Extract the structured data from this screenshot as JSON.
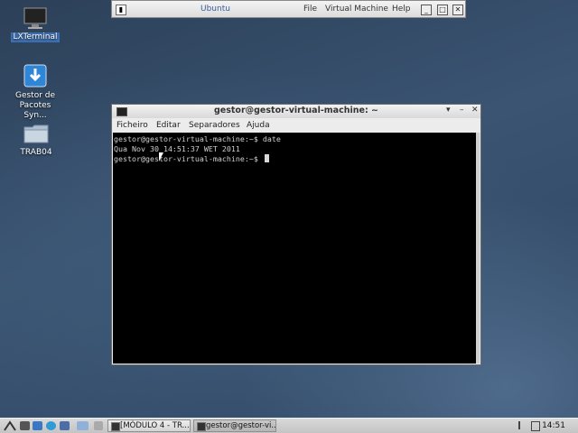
{
  "desktop": {
    "icons": [
      {
        "label": "LXTerminal"
      },
      {
        "label": "Gestor de Pacotes Syn..."
      },
      {
        "label": "TRAB04"
      }
    ]
  },
  "vm_window": {
    "title": "Ubuntu",
    "menu": [
      "File",
      "Virtual Machine",
      "Help"
    ],
    "controls": [
      "_",
      "□",
      "✕"
    ]
  },
  "terminal": {
    "title": "gestor@gestor-virtual-machine: ~",
    "controls": [
      "▾",
      "–",
      "✕"
    ],
    "menu": [
      "Ficheiro",
      "Editar",
      "Separadores",
      "Ajuda"
    ],
    "lines": [
      "gestor@gestor-virtual-machine:~$ date",
      "Qua Nov 30 14:51:37 WET 2011",
      "gestor@gestor-virtual-machine:~$ "
    ]
  },
  "taskbar": {
    "tasks": [
      "[MÓDULO 4 - TR...",
      "gestor@gestor-vi..."
    ],
    "clock": "14:51"
  },
  "colors": {
    "terminal_bg": "#000000",
    "desktop": "#3a5472",
    "selection": "#3f6fb0"
  }
}
